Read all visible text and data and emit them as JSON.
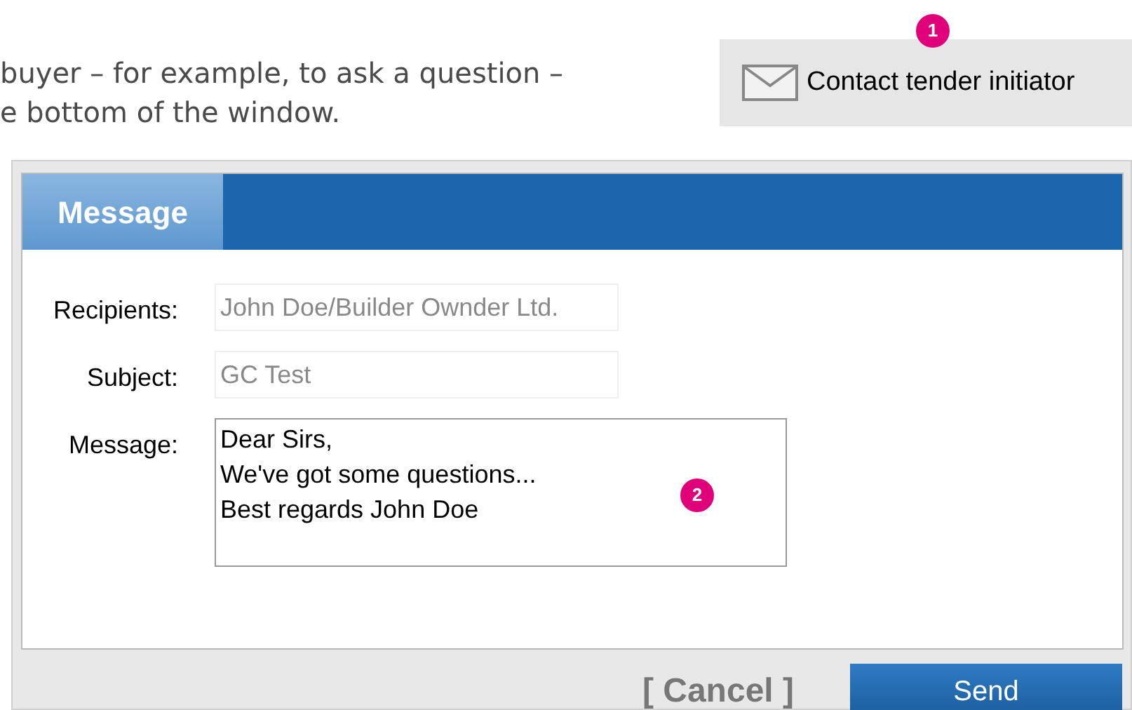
{
  "intro_lines": [
    "buyer – for example, to ask a question –",
    "e bottom of the window."
  ],
  "contact_button": {
    "label": "Contact tender initiator",
    "callout": "1"
  },
  "dialog": {
    "tab": {
      "label": "Message",
      "selected": true
    },
    "fields": [
      {
        "kind": "input",
        "label": "Recipients:",
        "value": "John Doe/Builder Ownder Ltd."
      },
      {
        "kind": "input",
        "label": "Subject:",
        "value": "GC Test"
      },
      {
        "kind": "textarea",
        "label": "Message:",
        "value": "Dear Sirs,\nWe've got some questions...\nBest regards John Doe",
        "callout": "2"
      }
    ],
    "cancel": "[ Cancel ]",
    "send": "Send"
  }
}
